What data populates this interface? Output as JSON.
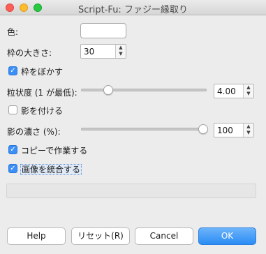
{
  "window": {
    "title": "Script-Fu: ファジー縁取り"
  },
  "form": {
    "color_label": "色:",
    "border_size_label": "枠の大きさ:",
    "border_size_value": "30",
    "blur_label": "枠をぼかす",
    "blur_checked": true,
    "granularity_label": "粒状度 (1 が最低):",
    "granularity_value": "4.00",
    "granularity_level": 0.25,
    "shadow_label": "影を付ける",
    "shadow_checked": false,
    "shadow_weight_label": "影の濃さ (%):",
    "shadow_weight_value": "100",
    "shadow_weight_level": 1.0,
    "copy_label": "コピーで作業する",
    "copy_checked": true,
    "flatten_label": "画像を統合する",
    "flatten_checked": true
  },
  "buttons": {
    "help": "Help",
    "reset": "リセット(R)",
    "cancel": "Cancel",
    "ok": "OK"
  },
  "icons": {
    "spin_up": "▲",
    "spin_down": "▼",
    "check": "✓"
  }
}
